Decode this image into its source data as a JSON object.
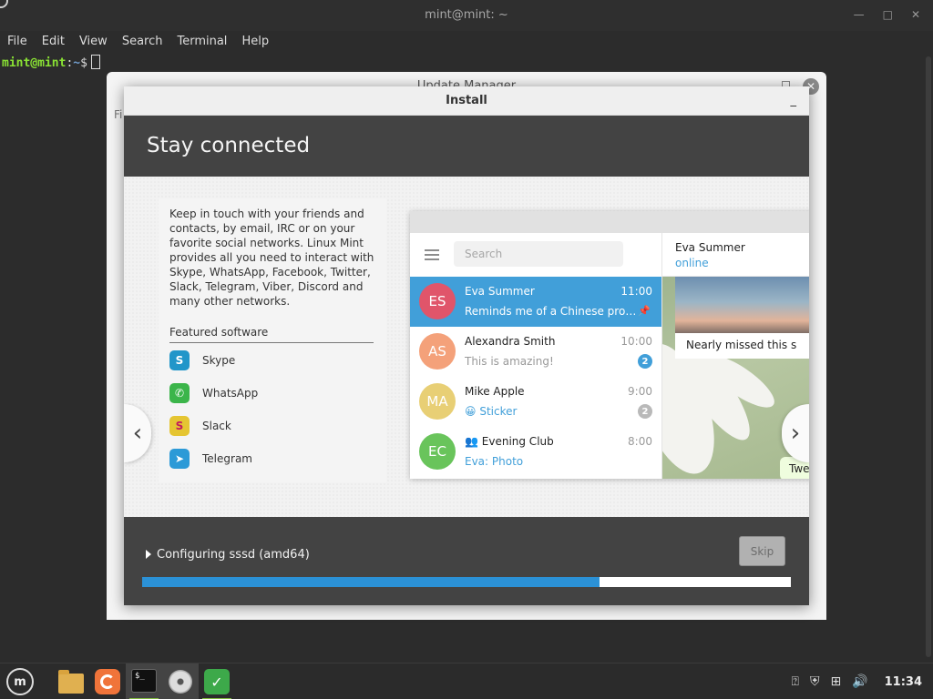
{
  "terminal": {
    "title": "mint@mint: ~",
    "menus": [
      "File",
      "Edit",
      "View",
      "Search",
      "Terminal",
      "Help"
    ],
    "prompt_user": "mint@mint",
    "prompt_path": "~",
    "prompt_symbol": "$"
  },
  "update_manager": {
    "title": "Update Manager",
    "menu_fragment": "Fi"
  },
  "install": {
    "title": "Install",
    "minimize": "_",
    "heading": "Stay connected",
    "intro": "Keep in touch with your friends and contacts, by email, IRC or on your favorite social networks. Linux Mint provides all you need to interact with Skype, WhatsApp, Facebook, Twitter, Slack, Telegram, Viber, Discord and many other networks.",
    "featured_heading": "Featured software",
    "apps": [
      {
        "name": "Skype",
        "icon": "skype-icon",
        "color": "#2196c9",
        "glyph": "S"
      },
      {
        "name": "WhatsApp",
        "icon": "whatsapp-icon",
        "color": "#3bb54a",
        "glyph": "✆"
      },
      {
        "name": "Slack",
        "icon": "slack-icon",
        "color": "#e5c532",
        "glyph": "S"
      },
      {
        "name": "Telegram",
        "icon": "telegram-icon",
        "color": "#2c9ad7",
        "glyph": "➤"
      }
    ],
    "prev_arrow": "‹",
    "next_arrow": "›",
    "status": "Configuring sssd (amd64)",
    "skip_label": "Skip",
    "progress": 0.705,
    "progress_color": "#2b91d6"
  },
  "telegram": {
    "search_placeholder": "Search",
    "contact_name": "Eva Summer",
    "contact_status": "online",
    "photo_caption": "Nearly missed this s",
    "bubble_text": "Twe",
    "chats": [
      {
        "initials": "ES",
        "name": "Eva Summer",
        "time": "11:00",
        "message": "Reminds me of a Chinese prover...",
        "avatar_color": "#e0556a",
        "badge": "",
        "pinned": true
      },
      {
        "initials": "AS",
        "name": "Alexandra Smith",
        "time": "10:00",
        "message": "This is amazing!",
        "avatar_color": "#f4a17a",
        "badge": "2",
        "badge_color": "#419fd9"
      },
      {
        "initials": "MA",
        "name": "Mike Apple",
        "time": "9:00",
        "message": "😀 Sticker",
        "avatar_color": "#e8cf75",
        "badge": "2",
        "badge_color": "#b9b9b9"
      },
      {
        "initials": "EC",
        "name": "Evening Club",
        "time": "8:00",
        "message": "Eva: Photo",
        "avatar_color": "#69c45b",
        "badge": ""
      }
    ]
  },
  "taskbar": {
    "clock": "11:34",
    "mint_label": "m"
  }
}
